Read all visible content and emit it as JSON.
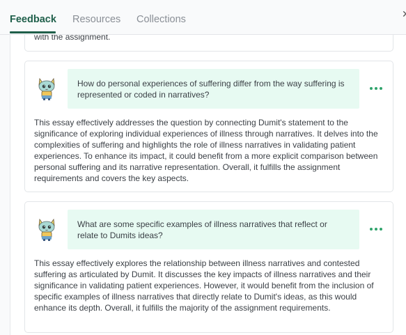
{
  "tabs": [
    {
      "label": "Feedback",
      "active": true
    },
    {
      "label": "Resources",
      "active": false
    },
    {
      "label": "Collections",
      "active": false
    }
  ],
  "previous_card": {
    "tail_text": "with the assignment."
  },
  "cards": [
    {
      "question": "How do personal experiences of suffering differ from the way suffering is represented or coded in narratives?",
      "feedback": "This essay effectively addresses the question by connecting Dumit's statement to the significance of exploring individual experiences of illness through narratives. It delves into the complexities of suffering and highlights the role of illness narratives in validating patient experiences. To enhance its impact, it could benefit from a more explicit comparison between personal suffering and its narrative representation. Overall, it fulfills the assignment requirements and covers the key aspects."
    },
    {
      "question": "What are some specific examples of illness narratives that reflect or relate to Dumits ideas?",
      "feedback": "This essay effectively explores the relationship between illness narratives and contested suffering as articulated by Dumit. It discusses the key impacts of illness narratives and their significance in validating patient experiences. However, it would benefit from the inclusion of specific examples of illness narratives that directly relate to Dumit's ideas, as this would enhance its depth. Overall, it fulfills the majority of the assignment requirements."
    }
  ],
  "icons": {
    "avatar": "cat-avatar-icon",
    "more": "more-options-icon"
  },
  "colors": {
    "accent": "#1f5f4a",
    "question_bg": "#e7faf2",
    "dots": "#2fa36b"
  }
}
